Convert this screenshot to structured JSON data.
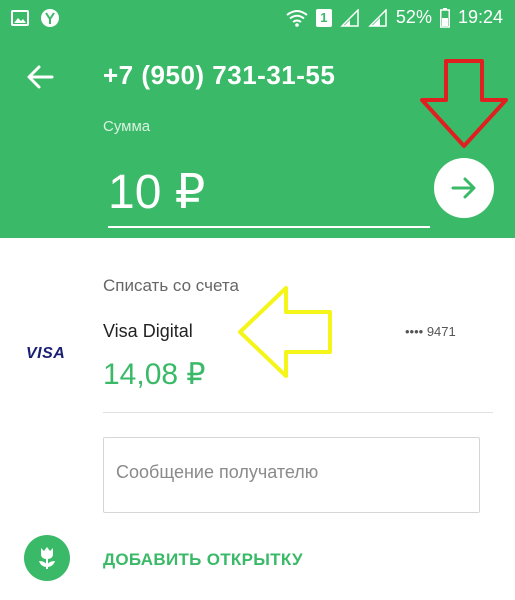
{
  "status_bar": {
    "battery": "52%",
    "time": "19:24",
    "sim_badge": "1"
  },
  "header": {
    "phone": "+7 (950) 731-31-55",
    "sum_label": "Сумма",
    "amount": "10 ₽"
  },
  "account": {
    "label": "Списать со счета",
    "card_brand": "VISA",
    "card_name": "Visa Digital",
    "card_mask": "•••• 9471",
    "balance": "14,08 ₽"
  },
  "message": {
    "placeholder": "Сообщение получателю"
  },
  "postcard": {
    "label": "ДОБАВИТЬ ОТКРЫТКУ"
  },
  "colors": {
    "brand_green": "#3aba68",
    "annotation_red": "#e02020",
    "annotation_yellow": "#f5f51a"
  }
}
